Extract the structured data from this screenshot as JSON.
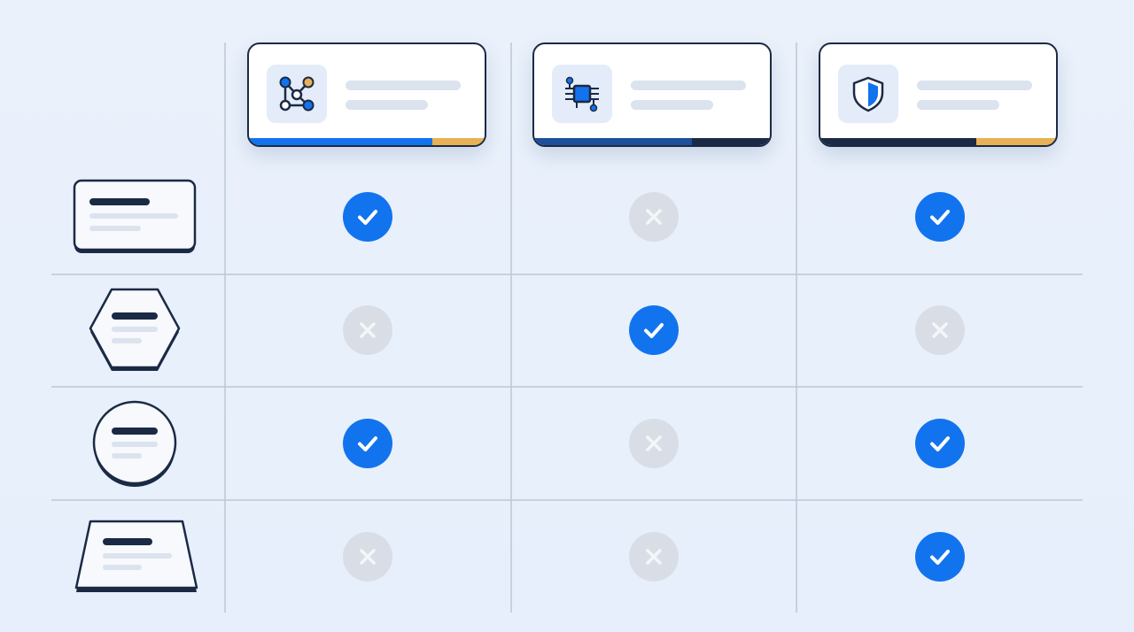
{
  "colors": {
    "accent": "#1273ee",
    "navy": "#1b2a44",
    "gold": "#e8b155",
    "inactive": "#d9dee6"
  },
  "columns": [
    {
      "icon": "network-graph-icon",
      "bar": [
        {
          "color": "#1273ee",
          "fraction": 0.78
        },
        {
          "color": "#e8b155",
          "fraction": 0.22
        }
      ]
    },
    {
      "icon": "circuit-chip-icon",
      "bar": [
        {
          "color": "#1c4f9c",
          "fraction": 0.67
        },
        {
          "color": "#1b2a44",
          "fraction": 0.33
        }
      ]
    },
    {
      "icon": "shield-icon",
      "bar": [
        {
          "color": "#1b2a44",
          "fraction": 0.66
        },
        {
          "color": "#e8b155",
          "fraction": 0.34
        }
      ]
    }
  ],
  "rows": [
    {
      "shape": "rectangle-card",
      "supported": [
        true,
        false,
        true
      ]
    },
    {
      "shape": "hexagon-card",
      "supported": [
        false,
        true,
        false
      ]
    },
    {
      "shape": "circle-card",
      "supported": [
        true,
        false,
        true
      ]
    },
    {
      "shape": "trapezoid-card",
      "supported": [
        false,
        false,
        true
      ]
    }
  ]
}
